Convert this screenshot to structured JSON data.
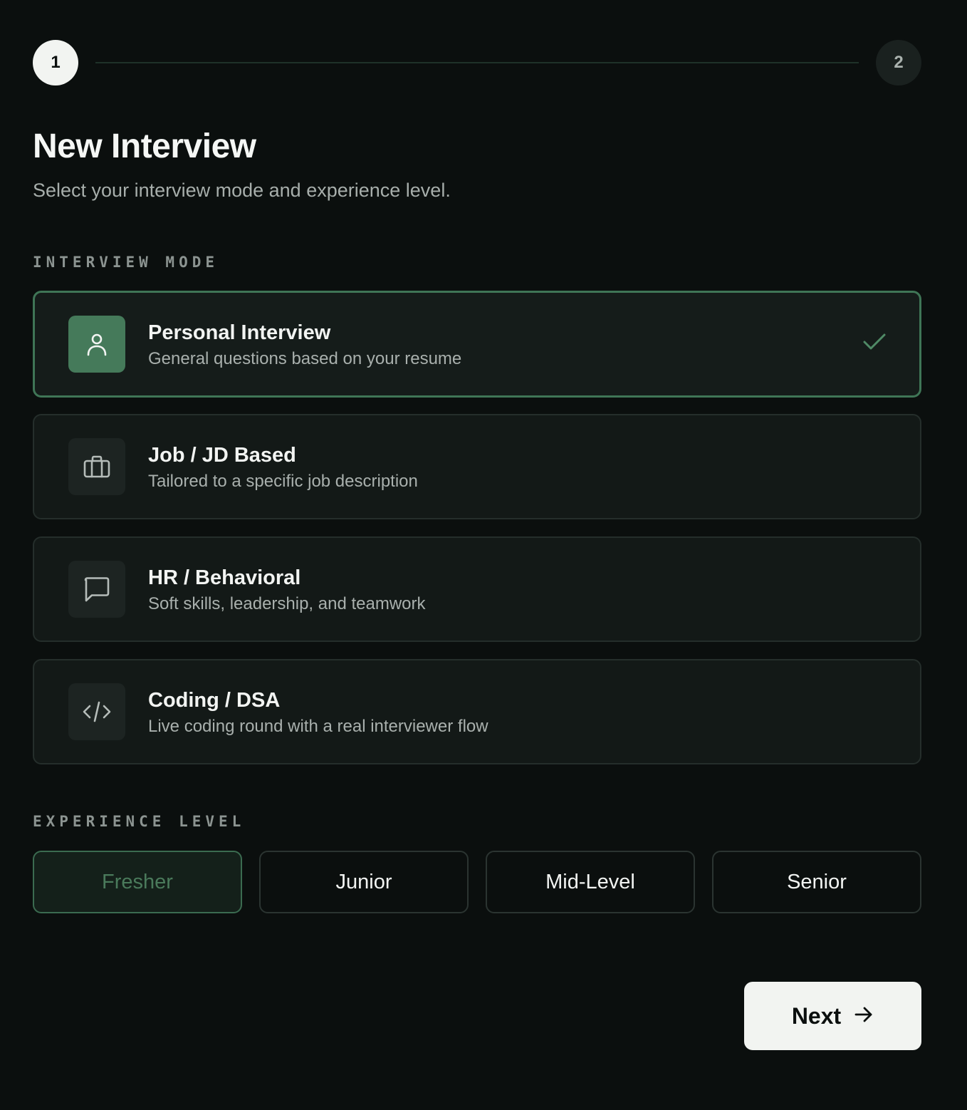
{
  "stepper": {
    "steps": [
      {
        "number": "1",
        "state": "active"
      },
      {
        "number": "2",
        "state": "inactive"
      }
    ]
  },
  "header": {
    "title": "New Interview",
    "subtitle": "Select your interview mode and experience level."
  },
  "interview_mode": {
    "label": "INTERVIEW MODE",
    "options": [
      {
        "title": "Personal Interview",
        "description": "General questions based on your resume",
        "icon": "user-icon",
        "selected": true
      },
      {
        "title": "Job / JD Based",
        "description": "Tailored to a specific job description",
        "icon": "briefcase-icon",
        "selected": false
      },
      {
        "title": "HR / Behavioral",
        "description": "Soft skills, leadership, and teamwork",
        "icon": "chat-bubble-icon",
        "selected": false
      },
      {
        "title": "Coding / DSA",
        "description": "Live coding round with a real interviewer flow",
        "icon": "code-icon",
        "selected": false
      }
    ]
  },
  "experience_level": {
    "label": "EXPERIENCE LEVEL",
    "options": [
      {
        "label": "Fresher",
        "selected": true
      },
      {
        "label": "Junior",
        "selected": false
      },
      {
        "label": "Mid-Level",
        "selected": false
      },
      {
        "label": "Senior",
        "selected": false
      }
    ]
  },
  "footer": {
    "next_label": "Next",
    "next_icon": "arrow-right-icon"
  },
  "colors": {
    "background": "#0b0f0e",
    "accent": "#457a5a",
    "selected_border": "#3f7556"
  }
}
